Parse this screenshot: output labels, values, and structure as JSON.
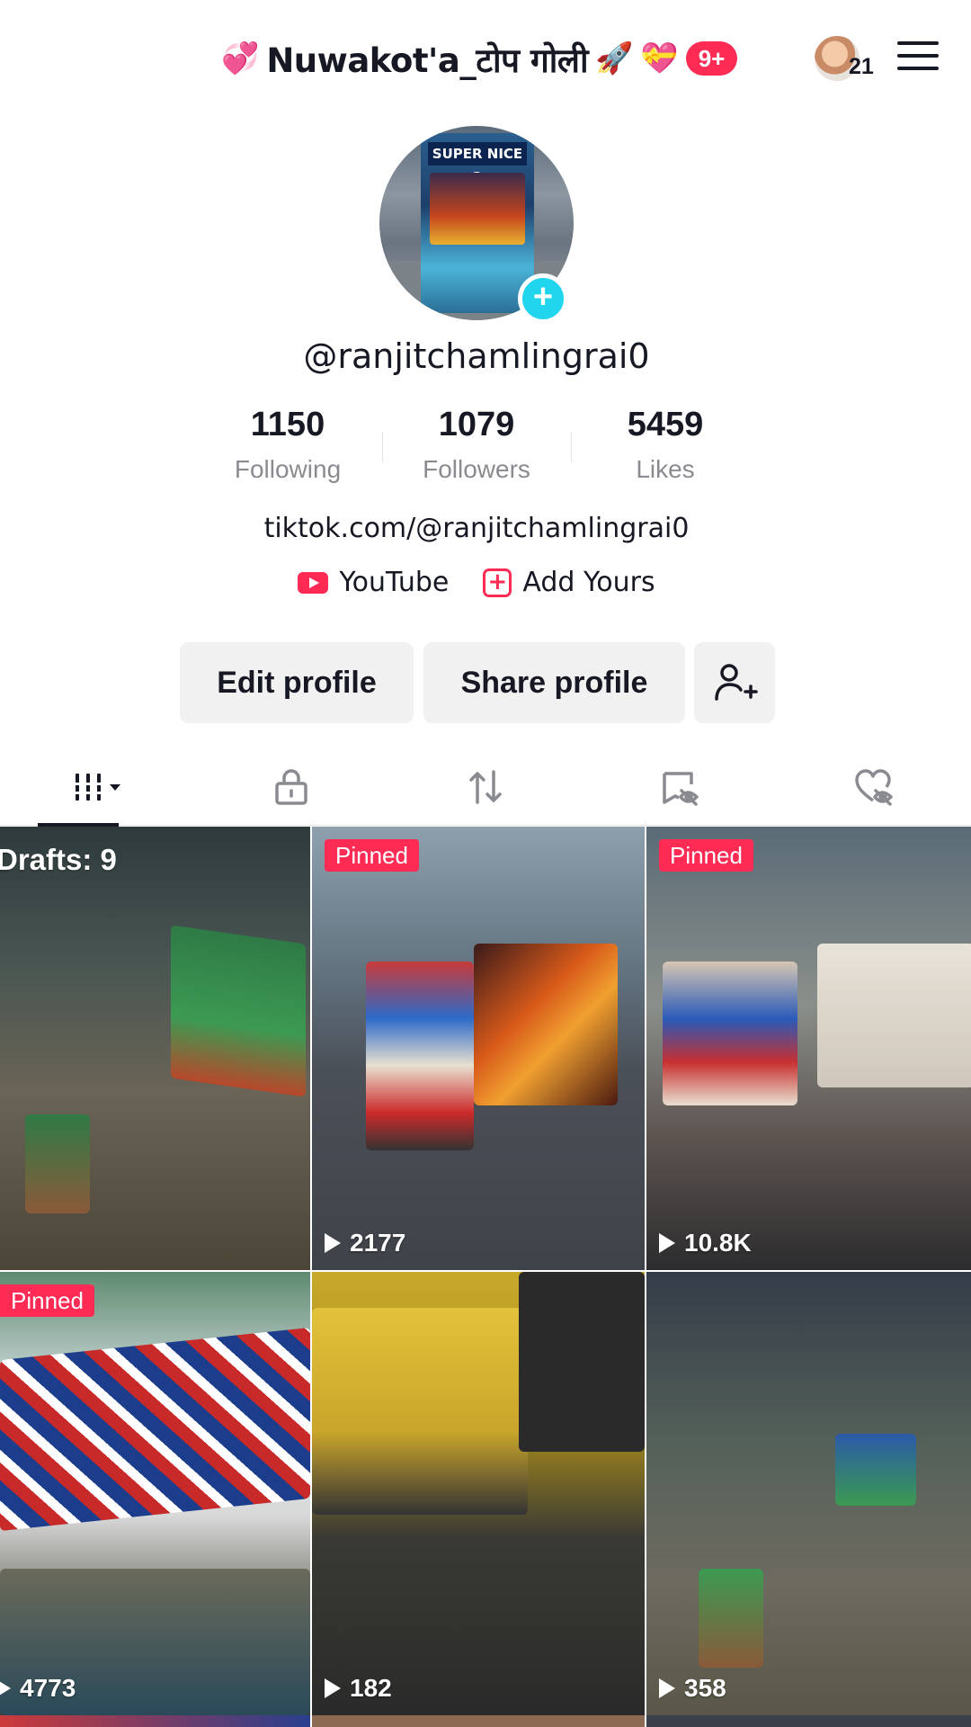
{
  "header": {
    "title_text": "Nuwakot'a_टोप गोली",
    "title_emoji_left": "💞",
    "title_emoji_rocket": "🚀",
    "title_emoji_gift": "💝",
    "notification_badge": "9+",
    "friends_count": "21"
  },
  "profile": {
    "username": "@ranjitchamlingrai0",
    "stats": [
      {
        "value": "1150",
        "label": "Following"
      },
      {
        "value": "1079",
        "label": "Followers"
      },
      {
        "value": "5459",
        "label": "Likes"
      }
    ],
    "bio_link": "tiktok.com/@ranjitchamlingrai0",
    "chips": {
      "youtube": "YouTube",
      "add_yours": "Add Yours"
    }
  },
  "actions": {
    "edit_profile": "Edit profile",
    "share_profile": "Share profile"
  },
  "tabs": [
    "videos-tab",
    "private-tab",
    "reposts-tab",
    "favorites-tab",
    "liked-tab"
  ],
  "grid": {
    "drafts_label": "Drafts: 9",
    "pinned_label": "Pinned",
    "tiles": [
      {
        "views": ""
      },
      {
        "views": "2177"
      },
      {
        "views": "10.8K"
      },
      {
        "views": "4773"
      },
      {
        "views": "182"
      },
      {
        "views": "358"
      }
    ]
  },
  "colors": {
    "accent": "#fe2c55",
    "add_avatar": "#20d5ec",
    "text": "#161823",
    "muted": "#8a8b91",
    "button_bg": "#f1f1f2"
  }
}
